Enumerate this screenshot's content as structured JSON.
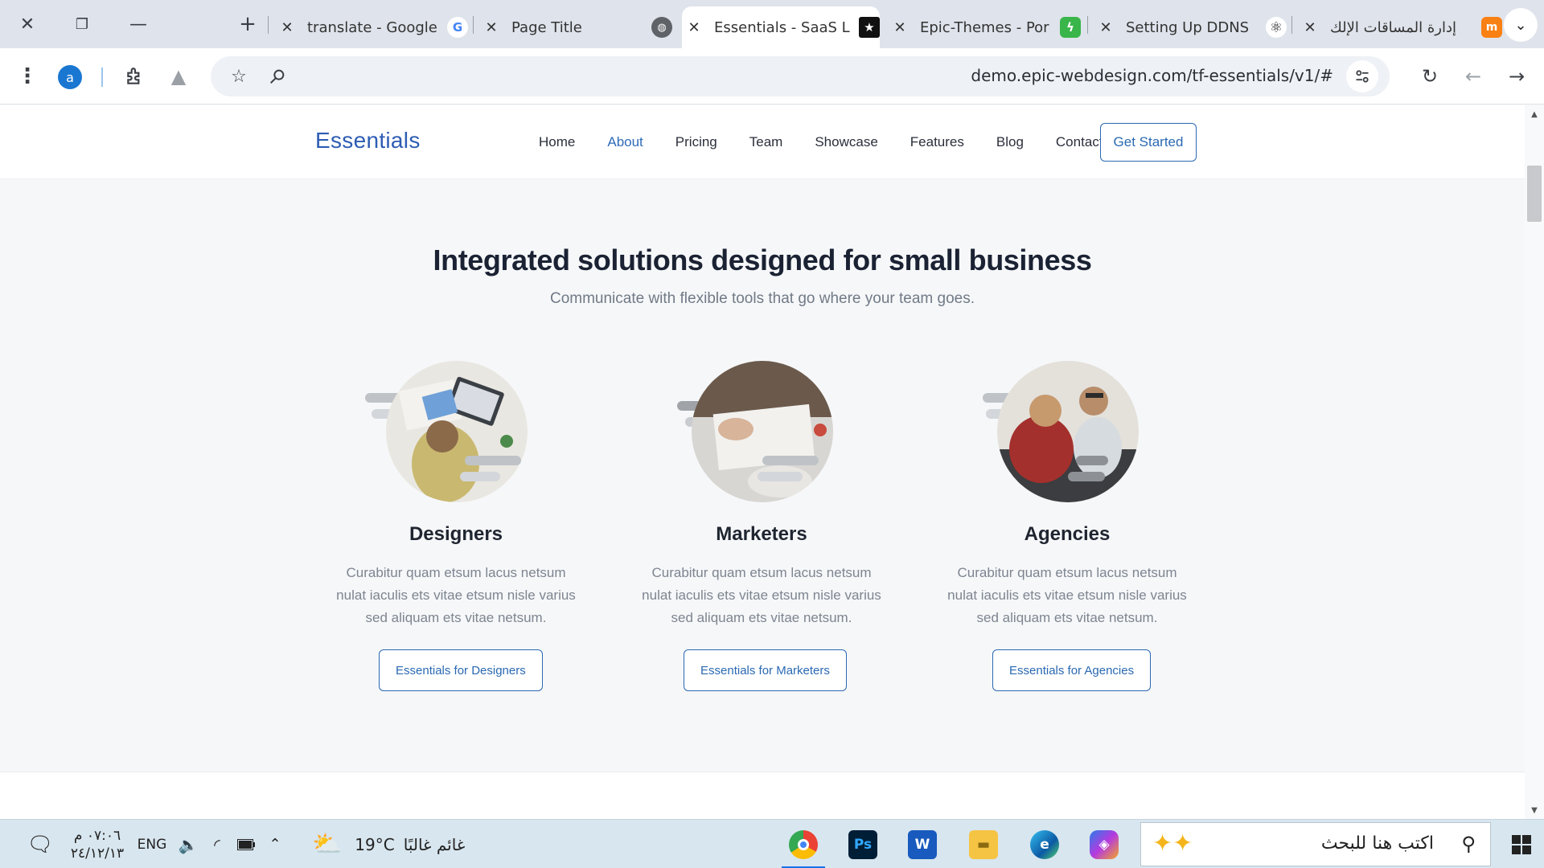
{
  "browser": {
    "tabs": [
      {
        "title": "translate - Google",
        "favicon": "google-icon"
      },
      {
        "title": "Page Title",
        "favicon": "globe-icon"
      },
      {
        "title": "Essentials - SaaS L",
        "favicon": "star-icon",
        "active": true
      },
      {
        "title": "Epic-Themes - Por",
        "favicon": "bolt-icon"
      },
      {
        "title": "Setting Up DDNS",
        "favicon": "openai-icon"
      },
      {
        "title": "إدارة المساقات الإلك",
        "favicon": "moodle-icon"
      }
    ],
    "profile_initial": "a",
    "url": "demo.epic-webdesign.com/tf-essentials/v1/#"
  },
  "site": {
    "logo": "Essentials",
    "nav": [
      "Home",
      "About",
      "Pricing",
      "Team",
      "Showcase",
      "Features",
      "Blog",
      "Contact"
    ],
    "nav_active": "About",
    "cta": "Get Started",
    "hero_title": "Integrated solutions designed for small business",
    "hero_subtitle": "Communicate with flexible tools that go where your team goes.",
    "cards": [
      {
        "name": "Designers",
        "description": "Curabitur quam etsum lacus netsum nulat iaculis ets vitae etsum nisle varius sed aliquam ets vitae netsum.",
        "button": "Essentials for Designers"
      },
      {
        "name": "Marketers",
        "description": "Curabitur quam etsum lacus netsum nulat iaculis ets vitae etsum nisle varius sed aliquam ets vitae netsum.",
        "button": "Essentials for Marketers"
      },
      {
        "name": "Agencies",
        "description": "Curabitur quam etsum lacus netsum nulat iaculis ets vitae etsum nisle varius sed aliquam ets vitae netsum.",
        "button": "Essentials for Agencies"
      }
    ]
  },
  "taskbar": {
    "time": "٠٧:٠٦ م",
    "date": "٢٤/١٢/١٣",
    "language": "ENG",
    "temperature": "19°C",
    "weather": "غائم غالبًا",
    "search_placeholder": "اكتب هنا للبحث",
    "apps": [
      "chrome-icon",
      "photoshop-icon",
      "word-icon",
      "file-explorer-icon",
      "edge-icon",
      "copilot-icon"
    ]
  },
  "colors": {
    "brand": "#2e5db3",
    "accent": "#2a69b2",
    "heading": "#1a2233",
    "muted": "#7d8590"
  }
}
